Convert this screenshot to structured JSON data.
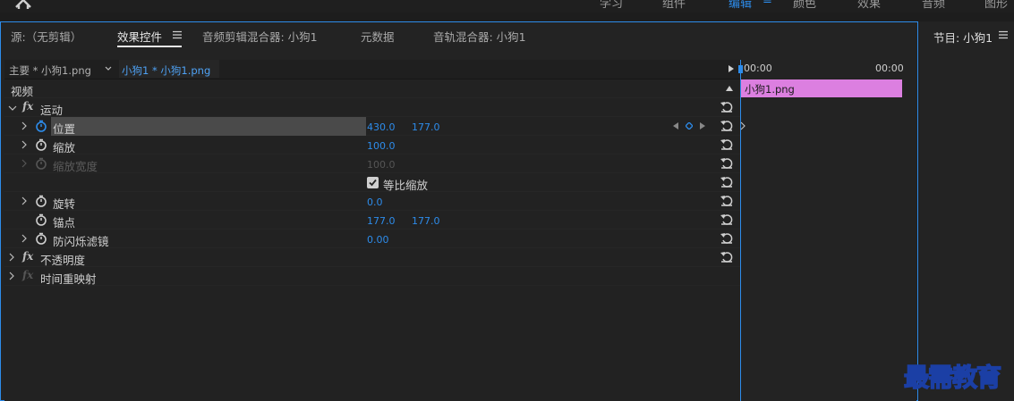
{
  "topbar": {
    "items": [
      "学习",
      "组件",
      "编辑",
      "颜色",
      "效果",
      "音频",
      "图形"
    ],
    "active_index": 2
  },
  "tabs": {
    "source": "源:（无剪辑）",
    "effect_controls": "效果控件",
    "audio_clip_mixer": "音频剪辑混合器: 小狗1",
    "metadata": "元数据",
    "audio_track_mixer": "音轨混合器: 小狗1"
  },
  "subheader": {
    "sequence": "主要 * 小狗1.png",
    "clip": "小狗1 * 小狗1.png"
  },
  "effects": {
    "section_video": "视频",
    "motion": "运动",
    "position": {
      "label": "位置",
      "x": "430.0",
      "y": "177.0"
    },
    "scale": {
      "label": "缩放",
      "value": "100.0"
    },
    "scale_width": {
      "label": "缩放宽度",
      "value": "100.0"
    },
    "uniform_scale": "等比缩放",
    "rotation": {
      "label": "旋转",
      "value": "0.0"
    },
    "anchor": {
      "label": "锚点",
      "x": "177.0",
      "y": "177.0"
    },
    "anti_flicker": {
      "label": "防闪烁滤镜",
      "value": "0.00"
    },
    "opacity": "不透明度",
    "time_remap": "时间重映射"
  },
  "timeline": {
    "tc_start": "00:00",
    "tc_end": "00:00",
    "clip_name": "小狗1.png"
  },
  "right_panel": {
    "title": "节目: 小狗1"
  },
  "watermark": "最需教育",
  "colors": {
    "accent": "#2d8ceb",
    "clip": "#dc7fe0",
    "selection": "#4a4a4a"
  }
}
